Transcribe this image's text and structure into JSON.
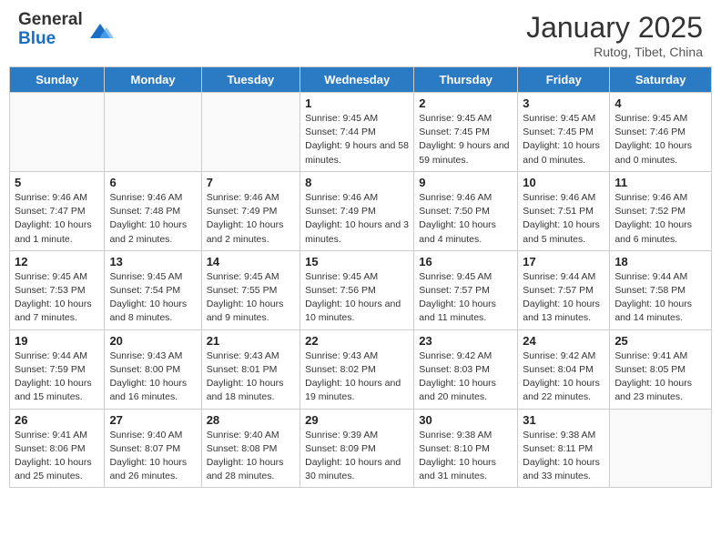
{
  "header": {
    "logo_general": "General",
    "logo_blue": "Blue",
    "month_year": "January 2025",
    "location": "Rutog, Tibet, China"
  },
  "weekdays": [
    "Sunday",
    "Monday",
    "Tuesday",
    "Wednesday",
    "Thursday",
    "Friday",
    "Saturday"
  ],
  "weeks": [
    [
      {
        "day": "",
        "info": "",
        "empty": true
      },
      {
        "day": "",
        "info": "",
        "empty": true
      },
      {
        "day": "",
        "info": "",
        "empty": true
      },
      {
        "day": "1",
        "info": "Sunrise: 9:45 AM\nSunset: 7:44 PM\nDaylight: 9 hours and 58 minutes."
      },
      {
        "day": "2",
        "info": "Sunrise: 9:45 AM\nSunset: 7:45 PM\nDaylight: 9 hours and 59 minutes."
      },
      {
        "day": "3",
        "info": "Sunrise: 9:45 AM\nSunset: 7:45 PM\nDaylight: 10 hours and 0 minutes."
      },
      {
        "day": "4",
        "info": "Sunrise: 9:45 AM\nSunset: 7:46 PM\nDaylight: 10 hours and 0 minutes."
      }
    ],
    [
      {
        "day": "5",
        "info": "Sunrise: 9:46 AM\nSunset: 7:47 PM\nDaylight: 10 hours and 1 minute."
      },
      {
        "day": "6",
        "info": "Sunrise: 9:46 AM\nSunset: 7:48 PM\nDaylight: 10 hours and 2 minutes."
      },
      {
        "day": "7",
        "info": "Sunrise: 9:46 AM\nSunset: 7:49 PM\nDaylight: 10 hours and 2 minutes."
      },
      {
        "day": "8",
        "info": "Sunrise: 9:46 AM\nSunset: 7:49 PM\nDaylight: 10 hours and 3 minutes."
      },
      {
        "day": "9",
        "info": "Sunrise: 9:46 AM\nSunset: 7:50 PM\nDaylight: 10 hours and 4 minutes."
      },
      {
        "day": "10",
        "info": "Sunrise: 9:46 AM\nSunset: 7:51 PM\nDaylight: 10 hours and 5 minutes."
      },
      {
        "day": "11",
        "info": "Sunrise: 9:46 AM\nSunset: 7:52 PM\nDaylight: 10 hours and 6 minutes."
      }
    ],
    [
      {
        "day": "12",
        "info": "Sunrise: 9:45 AM\nSunset: 7:53 PM\nDaylight: 10 hours and 7 minutes."
      },
      {
        "day": "13",
        "info": "Sunrise: 9:45 AM\nSunset: 7:54 PM\nDaylight: 10 hours and 8 minutes."
      },
      {
        "day": "14",
        "info": "Sunrise: 9:45 AM\nSunset: 7:55 PM\nDaylight: 10 hours and 9 minutes."
      },
      {
        "day": "15",
        "info": "Sunrise: 9:45 AM\nSunset: 7:56 PM\nDaylight: 10 hours and 10 minutes."
      },
      {
        "day": "16",
        "info": "Sunrise: 9:45 AM\nSunset: 7:57 PM\nDaylight: 10 hours and 11 minutes."
      },
      {
        "day": "17",
        "info": "Sunrise: 9:44 AM\nSunset: 7:57 PM\nDaylight: 10 hours and 13 minutes."
      },
      {
        "day": "18",
        "info": "Sunrise: 9:44 AM\nSunset: 7:58 PM\nDaylight: 10 hours and 14 minutes."
      }
    ],
    [
      {
        "day": "19",
        "info": "Sunrise: 9:44 AM\nSunset: 7:59 PM\nDaylight: 10 hours and 15 minutes."
      },
      {
        "day": "20",
        "info": "Sunrise: 9:43 AM\nSunset: 8:00 PM\nDaylight: 10 hours and 16 minutes."
      },
      {
        "day": "21",
        "info": "Sunrise: 9:43 AM\nSunset: 8:01 PM\nDaylight: 10 hours and 18 minutes."
      },
      {
        "day": "22",
        "info": "Sunrise: 9:43 AM\nSunset: 8:02 PM\nDaylight: 10 hours and 19 minutes."
      },
      {
        "day": "23",
        "info": "Sunrise: 9:42 AM\nSunset: 8:03 PM\nDaylight: 10 hours and 20 minutes."
      },
      {
        "day": "24",
        "info": "Sunrise: 9:42 AM\nSunset: 8:04 PM\nDaylight: 10 hours and 22 minutes."
      },
      {
        "day": "25",
        "info": "Sunrise: 9:41 AM\nSunset: 8:05 PM\nDaylight: 10 hours and 23 minutes."
      }
    ],
    [
      {
        "day": "26",
        "info": "Sunrise: 9:41 AM\nSunset: 8:06 PM\nDaylight: 10 hours and 25 minutes."
      },
      {
        "day": "27",
        "info": "Sunrise: 9:40 AM\nSunset: 8:07 PM\nDaylight: 10 hours and 26 minutes."
      },
      {
        "day": "28",
        "info": "Sunrise: 9:40 AM\nSunset: 8:08 PM\nDaylight: 10 hours and 28 minutes."
      },
      {
        "day": "29",
        "info": "Sunrise: 9:39 AM\nSunset: 8:09 PM\nDaylight: 10 hours and 30 minutes."
      },
      {
        "day": "30",
        "info": "Sunrise: 9:38 AM\nSunset: 8:10 PM\nDaylight: 10 hours and 31 minutes."
      },
      {
        "day": "31",
        "info": "Sunrise: 9:38 AM\nSunset: 8:11 PM\nDaylight: 10 hours and 33 minutes."
      },
      {
        "day": "",
        "info": "",
        "empty": true
      }
    ]
  ]
}
